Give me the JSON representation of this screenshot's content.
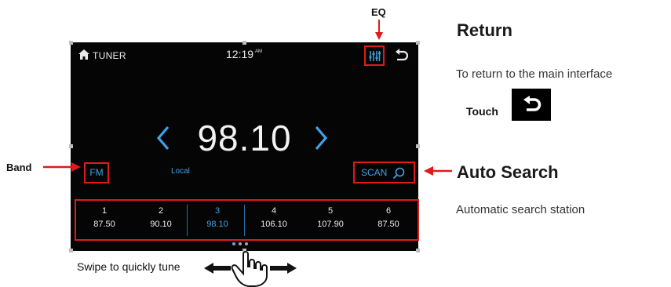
{
  "screen": {
    "title": "TUNER",
    "time": "12:19",
    "ampm": "AM",
    "frequency": "98.10",
    "band": "FM",
    "local": "Local",
    "scan": "SCAN",
    "presets": [
      {
        "num": "1",
        "freq": "87.50",
        "selected": false
      },
      {
        "num": "2",
        "freq": "90.10",
        "selected": false
      },
      {
        "num": "3",
        "freq": "98.10",
        "selected": true
      },
      {
        "num": "4",
        "freq": "106.10",
        "selected": false
      },
      {
        "num": "5",
        "freq": "107.90",
        "selected": false
      },
      {
        "num": "6",
        "freq": "87.50",
        "selected": false
      }
    ]
  },
  "annotations": {
    "eq": "EQ",
    "band": "Band",
    "swipe": "Swipe to quickly tune",
    "return_title": "Return",
    "return_desc": "To return to the main interface",
    "touch": "Touch",
    "auto_title": "Auto Search",
    "auto_desc": "Automatic search station"
  },
  "colors": {
    "accent": "#3fa2e6",
    "highlight": "#e01a1a",
    "screen_bg": "#050505"
  }
}
